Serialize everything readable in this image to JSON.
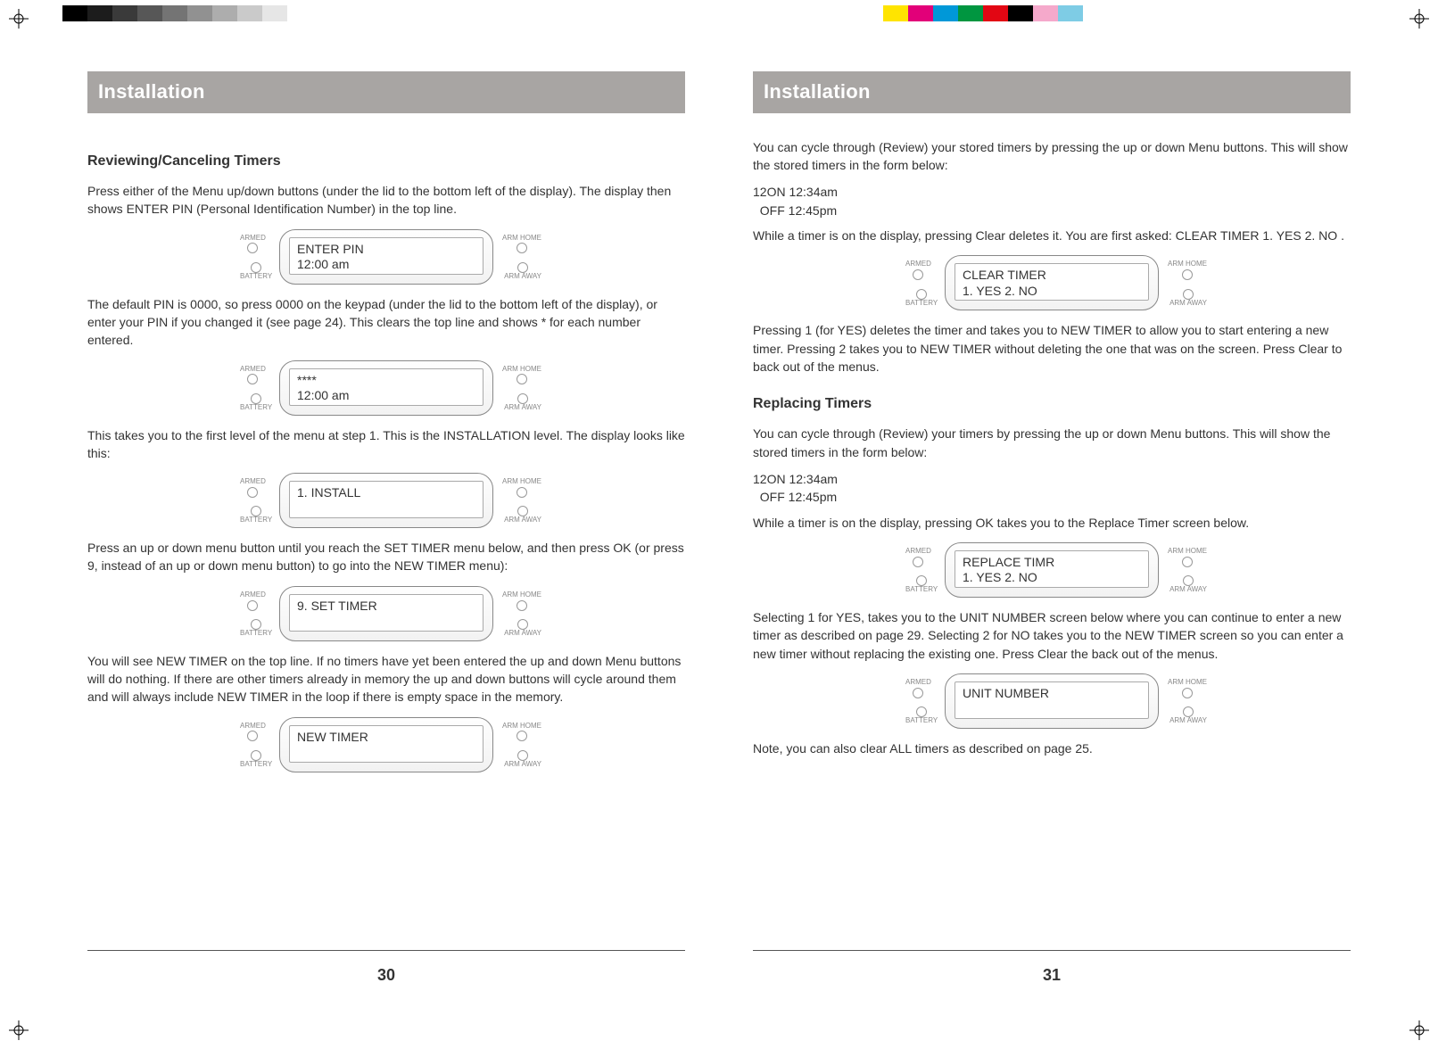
{
  "colorbar_left": [
    "#000000",
    "#1c1c1c",
    "#3a3a3a",
    "#575757",
    "#747474",
    "#919191",
    "#adadad",
    "#cacaca",
    "#e6e6e6",
    "#ffffff"
  ],
  "colorbar_right": [
    "#ffe400",
    "#e20079",
    "#0098d8",
    "#009640",
    "#e20613",
    "#000000",
    "#f5a9cb",
    "#7ecce5",
    "#ffffff"
  ],
  "left": {
    "heading": "Installation",
    "sub1": "Reviewing/Canceling Timers",
    "p1": "Press either of the Menu up/down buttons (under the lid to the bottom left of the display). The display then shows ENTER PIN (Personal Identification Number) in the top line.",
    "lcd1": {
      "line1": "ENTER PIN",
      "line2": "12:00 am"
    },
    "p2": "The default PIN is 0000, so press 0000 on the keypad (under the lid to the bottom left of the display), or enter your PIN if you changed it (see page 24). This clears the top line and shows * for each number entered.",
    "lcd2": {
      "line1": "****",
      "line2": "12:00 am"
    },
    "p3": "This takes you to the first level of the menu at step 1. This is the INSTALLATION level. The display looks like this:",
    "lcd3": {
      "line1": "1. INSTALL",
      "line2": ""
    },
    "p4": "Press an up or down menu button until you reach the SET TIMER menu below, and then press OK (or press 9, instead of an up or down menu button) to go into the NEW TIMER menu):",
    "lcd4": {
      "line1": "9. SET TIMER",
      "line2": ""
    },
    "p5": "You will see NEW TIMER on the top line. If no timers have yet been entered the up and down Menu buttons will do nothing. If there are other timers already in memory the up and down buttons will cycle around them and will always include NEW TIMER in the loop if there is empty space in the memory.",
    "lcd5": {
      "line1": "NEW TIMER",
      "line2": ""
    },
    "page_num": "30"
  },
  "right": {
    "heading": "Installation",
    "p1": "You can cycle through (Review) your stored timers by pressing the up or down Menu buttons. This will show the stored timers in the form below:",
    "timer_ex_l1": "12ON 12:34am",
    "timer_ex_l2": "  OFF 12:45pm",
    "p2": "While a timer is on the display, pressing Clear deletes it. You are first asked: CLEAR TIMER 1. YES 2. NO .",
    "lcd1": {
      "line1": "CLEAR TIMER",
      "line2": "1. YES 2. NO"
    },
    "p3": "Pressing 1 (for YES) deletes the timer and takes you to NEW TIMER to allow you to start entering a new timer. Pressing 2 takes you to NEW TIMER without deleting the one that was on the screen. Press Clear to back out of the menus.",
    "sub2": "Replacing Timers",
    "p4": "You can cycle through (Review) your timers by pressing the up or down Menu buttons. This will show the stored timers in the form below:",
    "timer_ex2_l1": "12ON 12:34am",
    "timer_ex2_l2": "  OFF 12:45pm",
    "p5": "While a timer is on the display, pressing OK takes you to the Replace Timer screen below.",
    "lcd2": {
      "line1": "REPLACE TIMR",
      "line2": "1. YES 2. NO"
    },
    "p6": "Selecting 1 for YES, takes you to the UNIT NUMBER screen below where you can continue to enter a new timer as described on page 29. Selecting 2 for NO takes you to the NEW TIMER screen so you can enter a new timer without replacing the existing one. Press Clear the back out of the menus.",
    "lcd3": {
      "line1": "UNIT NUMBER",
      "line2": ""
    },
    "p7": "Note, you can also clear ALL timers as described on page 25.",
    "page_num": "31"
  },
  "lcd_labels": {
    "armed": "ARMED",
    "battery": "BATTERY",
    "arm_home": "ARM HOME",
    "arm_away": "ARM AWAY"
  }
}
